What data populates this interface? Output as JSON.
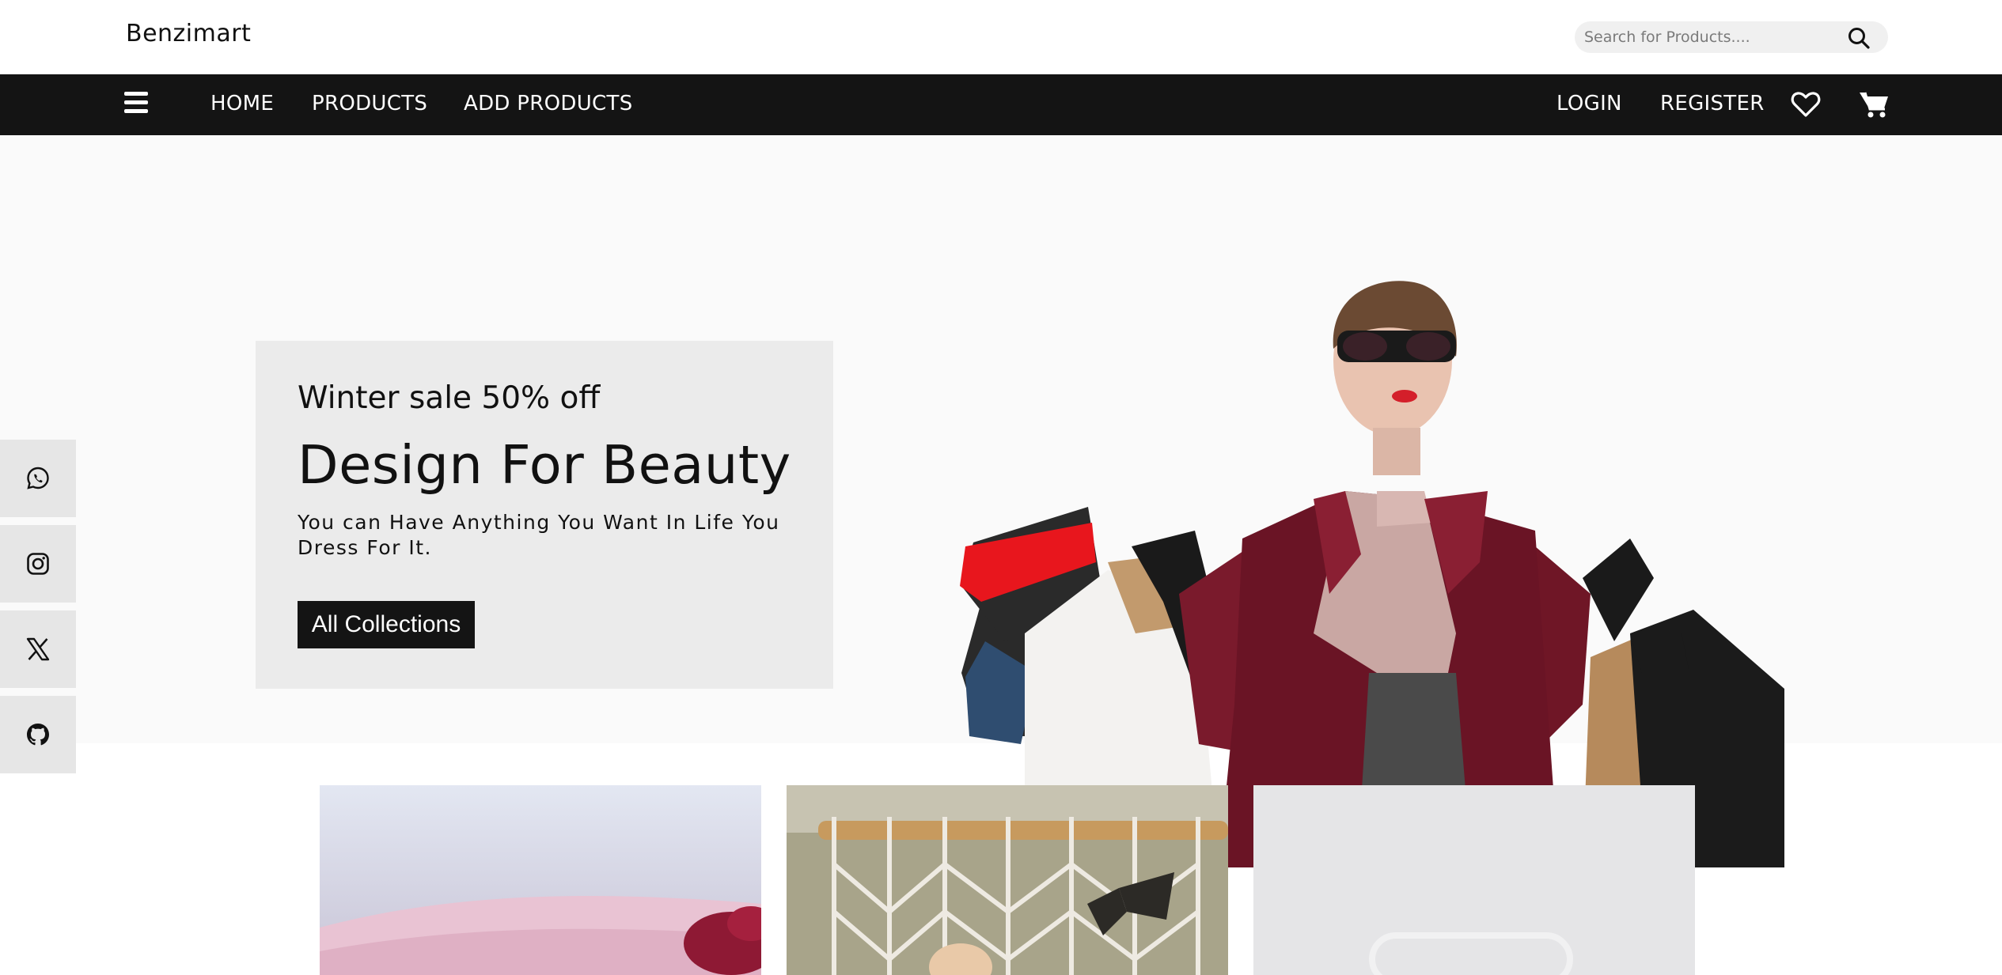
{
  "header": {
    "brand": "Benzimart",
    "search_placeholder": "Search for Products....",
    "search_icon": "search-icon"
  },
  "nav": {
    "menu_icon": "hamburger-icon",
    "links": [
      "HOME",
      "PRODUCTS",
      "ADD PRODUCTS"
    ],
    "auth": [
      "LOGIN",
      "REGISTER"
    ],
    "wishlist_icon": "heart-icon",
    "cart_icon": "cart-icon"
  },
  "hero": {
    "kicker": "Winter sale 50% off",
    "headline": "Design For Beauty",
    "tagline": "You can Have Anything You Want In Life You Dress For It.",
    "cta_label": "All Collections"
  },
  "social": [
    "whatsapp-icon",
    "instagram-icon",
    "x-icon",
    "github-icon"
  ],
  "colors": {
    "nav_bg": "#141414",
    "hero_bg": "#fafafa",
    "promo_bg": "#ebebeb",
    "social_bg": "#e6e6e6",
    "search_bg": "#f0f0f0"
  }
}
